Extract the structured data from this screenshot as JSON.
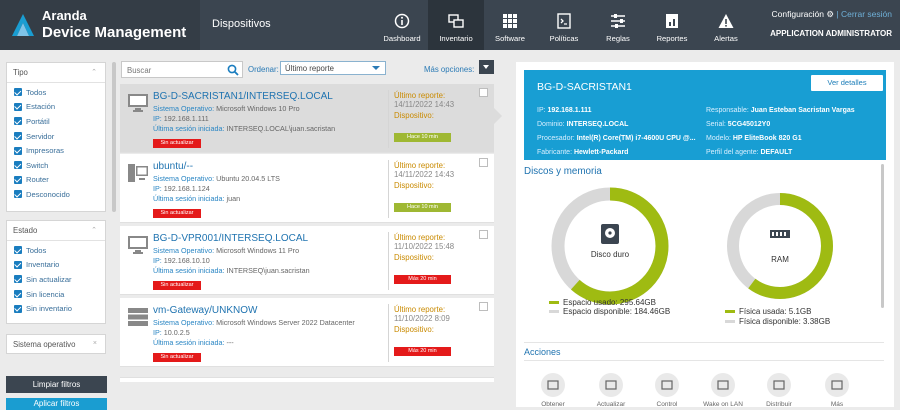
{
  "app": {
    "brand_line1": "Aranda",
    "brand_line2": "Device Management",
    "section": "Dispositivos"
  },
  "nav": [
    {
      "label": "Dashboard",
      "icon": "dashboard-icon"
    },
    {
      "label": "Inventario",
      "icon": "inventory-icon"
    },
    {
      "label": "Software",
      "icon": "software-icon"
    },
    {
      "label": "Políticas",
      "icon": "policies-icon"
    },
    {
      "label": "Reglas",
      "icon": "rules-icon"
    },
    {
      "label": "Reportes",
      "icon": "reports-icon"
    },
    {
      "label": "Alertas",
      "icon": "alerts-icon"
    }
  ],
  "user": {
    "config": "Configuración",
    "logout": "Cerrar sesión",
    "role": "APPLICATION ADMINISTRATOR"
  },
  "filters": {
    "tipo": {
      "title": "Tipo",
      "items": [
        "Todos",
        "Estación",
        "Portátil",
        "Servidor",
        "Impresoras",
        "Switch",
        "Router",
        "Desconocido"
      ]
    },
    "estado": {
      "title": "Estado",
      "items": [
        "Todos",
        "Inventario",
        "Sin actualizar",
        "Sin licencia",
        "Sin inventario"
      ]
    },
    "so": {
      "title": "Sistema operativo"
    },
    "clear": "Limpiar filtros",
    "apply": "Aplicar filtros"
  },
  "search": {
    "placeholder": "Buscar"
  },
  "order": {
    "label": "Ordenar:",
    "value": "Último reporte"
  },
  "more_options": "Más opciones:",
  "devices": [
    {
      "name": "BG-D-SACRISTAN1/INTERSEQ.LOCAL",
      "os": "Microsoft Windows 10 Pro",
      "ip": "192.168.1.111",
      "session": "INTERSEQ.LOCAL\\juan.sacristan",
      "status": "Sin actualizar",
      "last_report": "14/11/2022 14:43",
      "device_time": "Hace 10 min",
      "device_color": "#9fb833",
      "icon": "desktop-icon"
    },
    {
      "name": "ubuntu/--",
      "os": "Ubuntu 20.04.5 LTS",
      "ip": "192.168.1.124",
      "session": "juan",
      "status": "Sin actualizar",
      "last_report": "14/11/2022 14:43",
      "device_time": "Hace 10 min",
      "device_color": "#9fb833",
      "icon": "desktop-tower-icon"
    },
    {
      "name": "BG-D-VPR001/INTERSEQ.LOCAL",
      "os": "Microsoft Windows 11 Pro",
      "ip": "192.168.10.10",
      "session": "INTERSEQ\\juan.sacristan",
      "status": "Sin actualizar",
      "last_report": "11/10/2022 15:48",
      "device_time": "Más 20 min",
      "device_color": "#e41a1a",
      "icon": "desktop-icon"
    },
    {
      "name": "vm-Gateway/UNKNOW",
      "os": "Microsoft Windows Server 2022 Datacenter",
      "ip": "10.0.2.5",
      "session": "---",
      "status": "Sin actualizar",
      "last_report": "11/10/2022 8:09",
      "device_time": "Más 20 min",
      "device_color": "#e41a1a",
      "icon": "server-icon"
    }
  ],
  "labels": {
    "os": "Sistema Operativo:",
    "ip": "IP:",
    "session": "Última sesión iniciada:",
    "last_report": "Último reporte:",
    "device": "Dispositivo:"
  },
  "detail": {
    "title": "BG-D-SACRISTAN1",
    "view_details": "Ver detalles",
    "fields_left": [
      {
        "k": "IP:",
        "v": "192.168.1.111"
      },
      {
        "k": "Dominio:",
        "v": "INTERSEQ.LOCAL"
      },
      {
        "k": "Procesador:",
        "v": "Intel(R) Core(TM) i7-4600U CPU @..."
      },
      {
        "k": "Fabricante:",
        "v": "Hewlett-Packard"
      }
    ],
    "fields_right": [
      {
        "k": "Responsable:",
        "v": "Juan Esteban Sacristan Vargas"
      },
      {
        "k": "Serial:",
        "v": "5CG45012Y0"
      },
      {
        "k": "Modelo:",
        "v": "HP EliteBook 820 G1"
      },
      {
        "k": "Perfil del agente:",
        "v": "DEFAULT"
      }
    ]
  },
  "disks_title": "Discos y memoria",
  "disk": {
    "label": "Disco duro",
    "used_label": "Espacio usado: 295.64GB",
    "free_label": "Espacio disponible: 184.46GB",
    "used": 295.64,
    "free": 184.46,
    "used_color": "#9fbb12",
    "free_color": "#d8d8d8",
    "icon": "hard-drive-icon"
  },
  "ram": {
    "label": "RAM",
    "used_label": "Física usada: 5.1GB",
    "free_label": "Física disponible: 3.38GB",
    "used": 5.1,
    "free": 3.38,
    "used_color": "#9fbb12",
    "free_color": "#d8d8d8",
    "icon": "memory-icon"
  },
  "actions_title": "Acciones",
  "actions": [
    {
      "label": "Obtener",
      "icon": "obtain-icon"
    },
    {
      "label": "Actualizar",
      "icon": "update-icon"
    },
    {
      "label": "Control",
      "icon": "control-icon"
    },
    {
      "label": "Wake on LAN",
      "icon": "wake-icon"
    },
    {
      "label": "Distribuir",
      "icon": "distribute-icon"
    },
    {
      "label": "Más",
      "icon": "more-icon"
    }
  ]
}
